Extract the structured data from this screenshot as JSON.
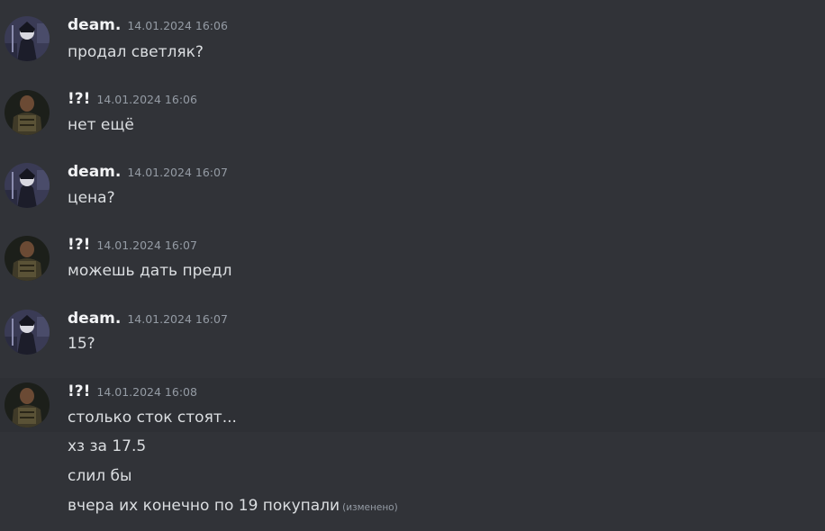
{
  "messages": [
    {
      "author": "deam.",
      "timestamp": "14.01.2024 16:06",
      "text": "продал светляк?"
    },
    {
      "author": "!?!",
      "timestamp": "14.01.2024 16:06",
      "text": "нет ещё"
    },
    {
      "author": "deam.",
      "timestamp": "14.01.2024 16:07",
      "text": "цена?"
    },
    {
      "author": "!?!",
      "timestamp": "14.01.2024 16:07",
      "text": "можешь дать предл"
    },
    {
      "author": "deam.",
      "timestamp": "14.01.2024 16:07",
      "text": "15?"
    },
    {
      "author": "!?!",
      "timestamp": "14.01.2024 16:08",
      "text": "столько сток стоят..."
    }
  ],
  "followups": [
    {
      "text": "хз за 17.5"
    },
    {
      "text": "слил бы"
    },
    {
      "text": "вчера их конечно по 19 покупали",
      "edited": "(изменено)"
    }
  ],
  "colors": {
    "background": "#313338",
    "hover_background": "#2e3035",
    "author": "#f2f3f5",
    "text": "#dbdee1",
    "muted": "#949ba4"
  }
}
